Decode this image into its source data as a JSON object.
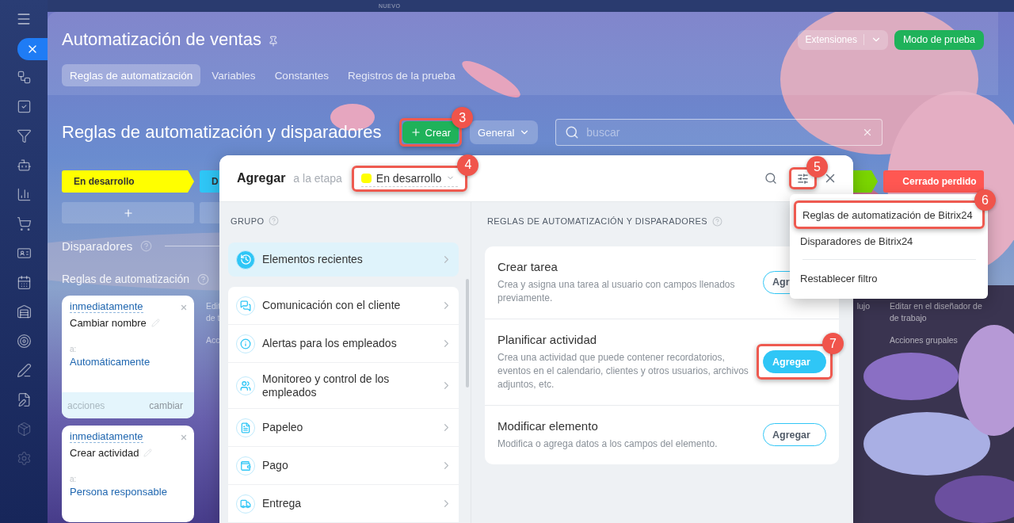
{
  "top_label": "NUEVO",
  "header": {
    "title": "Automatización de ventas",
    "extensions": "Extensiones",
    "test_mode": "Modo de prueba",
    "tabs": [
      {
        "label": "Reglas de automatización",
        "selected": true
      },
      {
        "label": "Variables",
        "selected": false
      },
      {
        "label": "Constantes",
        "selected": false
      },
      {
        "label": "Registros de la prueba",
        "selected": false
      }
    ]
  },
  "toolbar": {
    "title": "Reglas de automatización y disparadores",
    "create": {
      "label": "Crear",
      "callout": "3"
    },
    "filter": "General",
    "search": {
      "placeholder": "buscar"
    }
  },
  "stages_left": [
    {
      "label": "En desarrollo",
      "color": "#ffff00"
    },
    {
      "label": "D",
      "color": "#2fc6f6"
    }
  ],
  "stages_right": [
    {
      "color": "#7bd500"
    },
    {
      "label": "Cerrado perdido",
      "color": "#ff5752"
    }
  ],
  "triggers_heading": "Disparadores",
  "rules_heading": "Reglas de automatización",
  "cards": [
    {
      "timing": "inmediatamente",
      "action": "Cambiar nombre",
      "to_label": "a:",
      "to": "Automáticamente",
      "footer": {
        "left": "acciones",
        "right": "cambiar"
      }
    },
    {
      "timing": "inmediatamente",
      "action": "Crear actividad",
      "to_label": "a:",
      "to": "Persona responsable"
    }
  ],
  "column_2_notes": [
    {
      "lines": [
        "Edit",
        "de t"
      ]
    },
    {
      "lines": [
        "Acc"
      ]
    }
  ],
  "column_3_notes": [
    {
      "lines": [
        "lujo"
      ]
    }
  ],
  "column_4_notes": [
    {
      "lines": [
        "Editar en el diseñador de",
        "de trabajo"
      ]
    },
    {
      "lines": [
        "Acciones grupales"
      ]
    }
  ],
  "dialog": {
    "title": "Agregar",
    "subtitle": "a la etapa",
    "stage": {
      "label": "En desarrollo",
      "color": "#ffff00",
      "callout": "4"
    },
    "filter_callout": "5",
    "group_heading": "GRUPO",
    "recent": {
      "label": "Elementos recientes"
    },
    "groups": [
      {
        "label": "Comunicación con el cliente"
      },
      {
        "label": "Alertas para los empleados"
      },
      {
        "label": "Monitoreo y control de los empleados"
      },
      {
        "label": "Papeleo"
      },
      {
        "label": "Pago"
      },
      {
        "label": "Entrega"
      }
    ],
    "rules_heading": "REGLAS DE AUTOMATIZACIÓN Y DISPARADORES",
    "rules": [
      {
        "title": "Crear tarea",
        "description": "Crea y asigna una tarea al usuario con campos llenados previamente.",
        "button": "Agr",
        "primary": false
      },
      {
        "title": "Planificar actividad",
        "description": "Crea una actividad que puede contener recordatorios, eventos en el calendario, clientes y otros usuarios, archivos adjuntos, etc.",
        "button": "Agregar",
        "primary": true,
        "callout": "7"
      },
      {
        "title": "Modificar elemento",
        "description": "Modifica o agrega datos a los campos del elemento.",
        "button": "Agregar",
        "primary": false
      }
    ]
  },
  "menu": {
    "items": [
      {
        "label": "Reglas de automatización de Bitrix24",
        "kind": "option",
        "callout": "6"
      },
      {
        "label": "Disparadores de Bitrix24",
        "kind": "option"
      },
      {
        "label": "Restablecer filtro",
        "kind": "action"
      }
    ]
  }
}
